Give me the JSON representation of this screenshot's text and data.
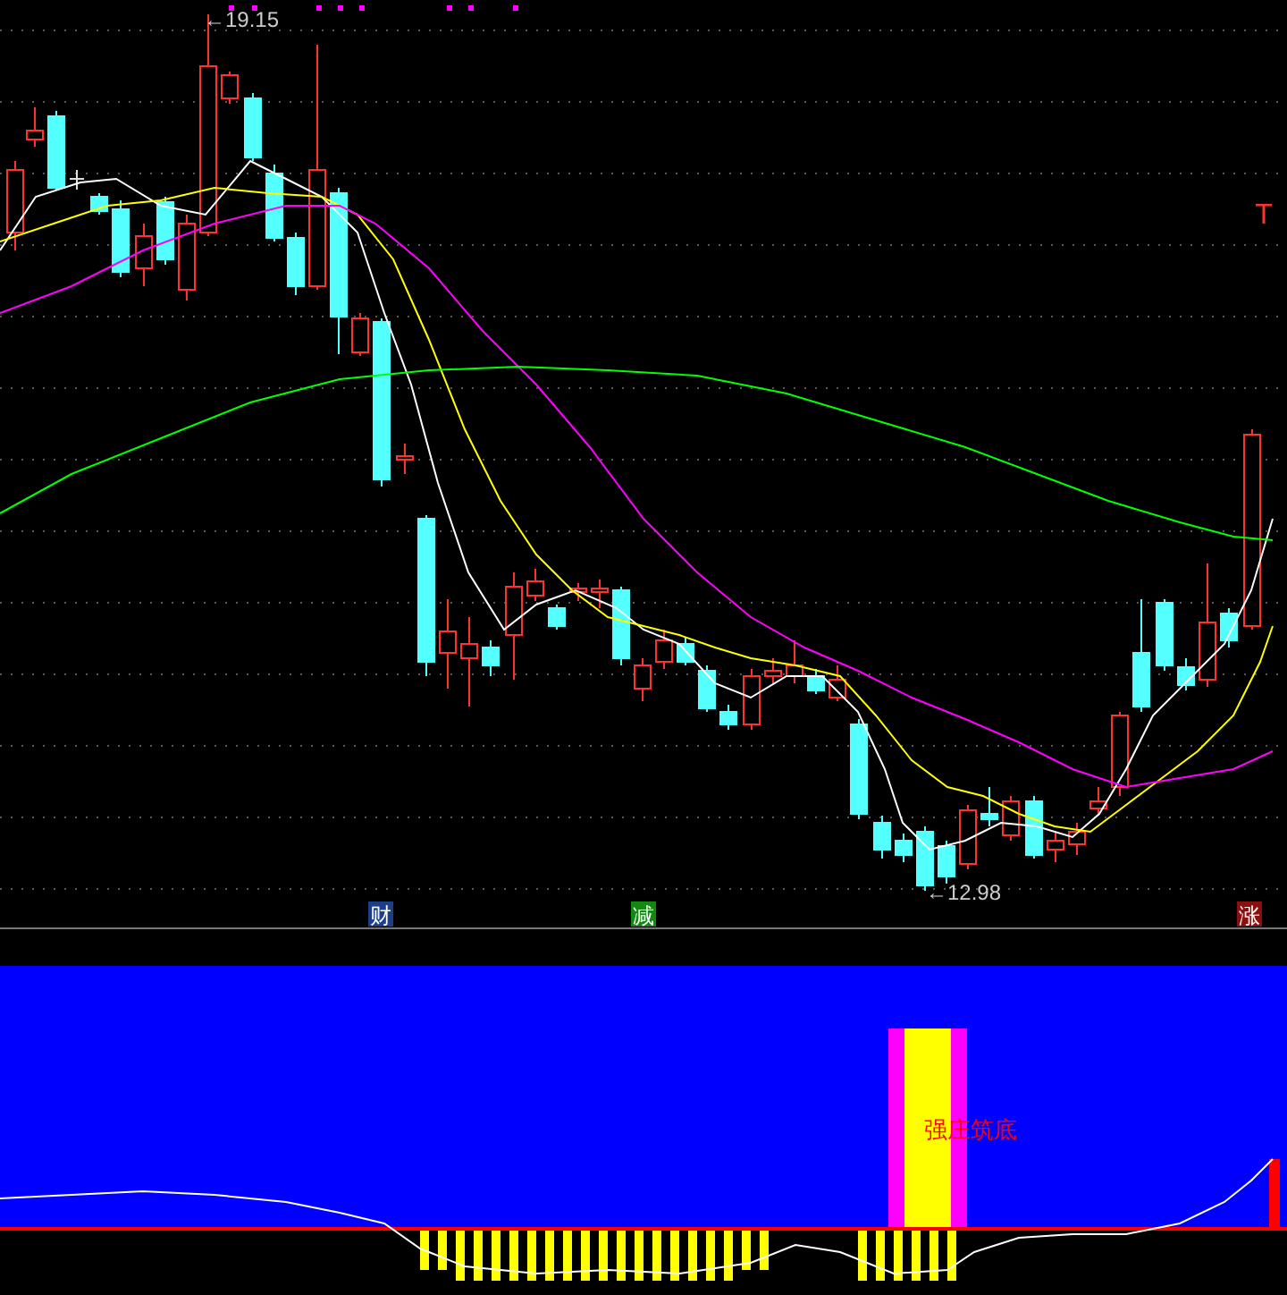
{
  "price_chart": {
    "high_label": "←19.15",
    "low_label": "←12.98",
    "signal": "T",
    "markers": [
      {
        "text": "财",
        "color": "#1c3f8a"
      },
      {
        "text": "减",
        "color": "#128a12"
      },
      {
        "text": "涨",
        "color": "#8a1010"
      }
    ]
  },
  "indicator_panel": {
    "signal_label": "强庄筑底"
  }
}
